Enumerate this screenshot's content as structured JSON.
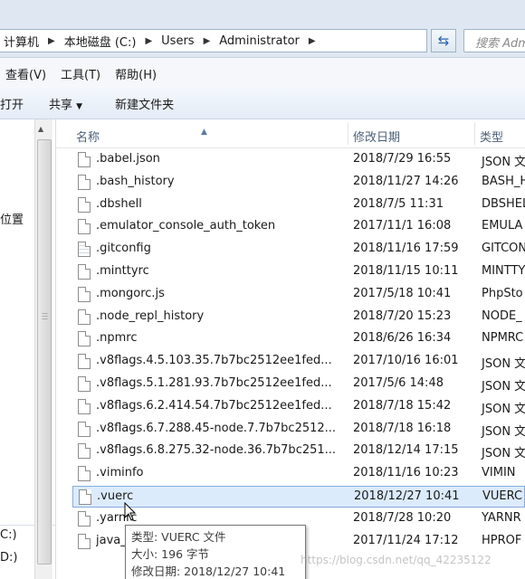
{
  "address": {
    "crumbs": [
      "计算机",
      "本地磁盘 (C:)",
      "Users",
      "Administrator"
    ],
    "search_placeholder": "搜索 Adm"
  },
  "menu": [
    "查看(V)",
    "工具(T)",
    "帮助(H)"
  ],
  "toolbar": {
    "open": "打开",
    "share": "共享",
    "new_folder": "新建文件夹"
  },
  "nav": {
    "recent_places": "位置",
    "drive_1": "C:)",
    "drive_2": "D:)"
  },
  "columns": {
    "name": "名称",
    "date": "修改日期",
    "type": "类型"
  },
  "files": [
    {
      "name": ".babel.json",
      "date": "2018/7/29 16:55",
      "type": "JSON 文",
      "icon": "file"
    },
    {
      "name": ".bash_history",
      "date": "2018/11/27 14:26",
      "type": "BASH_H",
      "icon": "file"
    },
    {
      "name": ".dbshell",
      "date": "2018/7/5 11:31",
      "type": "DBSHEL",
      "icon": "file"
    },
    {
      "name": ".emulator_console_auth_token",
      "date": "2017/11/1 16:08",
      "type": "EMULA",
      "icon": "file"
    },
    {
      "name": ".gitconfig",
      "date": "2018/11/16 17:59",
      "type": "GITCON",
      "icon": "config"
    },
    {
      "name": ".minttyrc",
      "date": "2018/11/15 10:11",
      "type": "MINTTY",
      "icon": "file"
    },
    {
      "name": ".mongorc.js",
      "date": "2017/5/18 10:41",
      "type": "PhpSto",
      "icon": "file"
    },
    {
      "name": ".node_repl_history",
      "date": "2018/7/20 15:23",
      "type": "NODE_",
      "icon": "file"
    },
    {
      "name": ".npmrc",
      "date": "2018/6/26 16:34",
      "type": "NPMRC",
      "icon": "file"
    },
    {
      "name": ".v8flags.4.5.103.35.7b7bc2512ee1fed...",
      "date": "2017/10/16 16:01",
      "type": "JSON 文",
      "icon": "file"
    },
    {
      "name": ".v8flags.5.1.281.93.7b7bc2512ee1fed...",
      "date": "2017/5/6 14:48",
      "type": "JSON 文",
      "icon": "file"
    },
    {
      "name": ".v8flags.6.2.414.54.7b7bc2512ee1fed...",
      "date": "2018/7/18 15:42",
      "type": "JSON 文",
      "icon": "file"
    },
    {
      "name": ".v8flags.6.7.288.45-node.7.7b7bc2512...",
      "date": "2018/7/18 16:18",
      "type": "JSON 文",
      "icon": "file"
    },
    {
      "name": ".v8flags.6.8.275.32-node.36.7b7bc251...",
      "date": "2018/12/14 17:15",
      "type": "JSON 文",
      "icon": "file"
    },
    {
      "name": ".viminfo",
      "date": "2018/11/16 10:23",
      "type": "VIMIN",
      "icon": "file"
    },
    {
      "name": ".vuerc",
      "date": "2018/12/27 10:41",
      "type": "VUERC",
      "icon": "file",
      "selected": true
    },
    {
      "name": ".yarnrc",
      "date": "2018/7/28 10:20",
      "type": "YARNR",
      "icon": "file"
    },
    {
      "name": "java_",
      "date": "2017/11/24 17:12",
      "type": "HPROF",
      "icon": "file"
    }
  ],
  "tooltip": {
    "type_line": "类型: VUERC 文件",
    "size_line": "大小: 196 字节",
    "date_line": "修改日期: 2018/12/27 10:41"
  },
  "watermark": "https://blog.csdn.net/qq_42235122"
}
